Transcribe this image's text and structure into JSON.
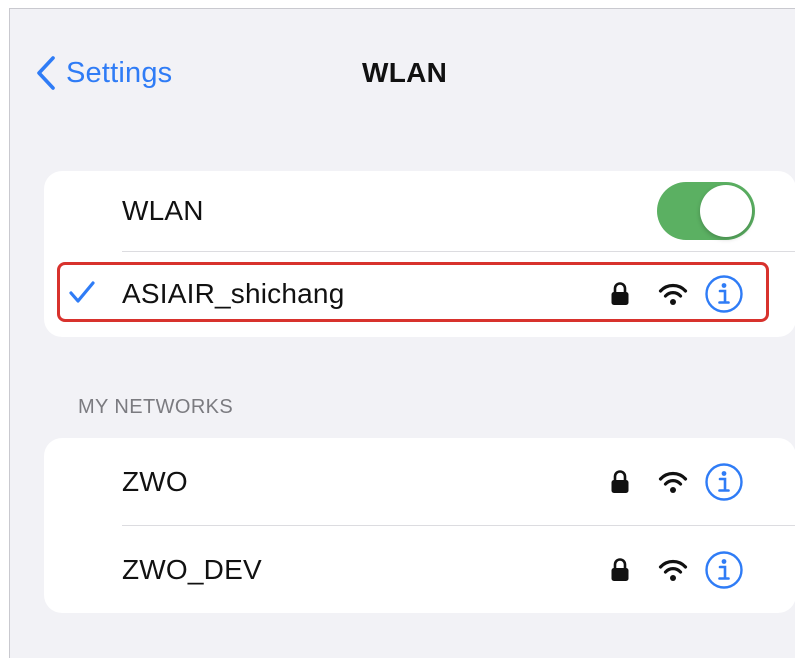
{
  "nav": {
    "back_label": "Settings",
    "title": "WLAN"
  },
  "wlan_toggle": {
    "label": "WLAN",
    "state": "on",
    "color": "#5bb062"
  },
  "connected_network": {
    "name": "ASIAIR_shichang",
    "connected": true,
    "secured": true,
    "highlight_color": "#d8322d"
  },
  "my_networks": {
    "header": "MY NETWORKS",
    "items": [
      {
        "name": "ZWO",
        "secured": true
      },
      {
        "name": "ZWO_DEV",
        "secured": true
      }
    ]
  },
  "colors": {
    "accent": "#2f7cf6",
    "background": "#f2f2f6",
    "card": "#ffffff"
  },
  "icons": {
    "back": "chevron-left-icon",
    "check": "checkmark-icon",
    "lock": "lock-icon",
    "wifi": "wifi-icon",
    "info": "info-icon"
  }
}
